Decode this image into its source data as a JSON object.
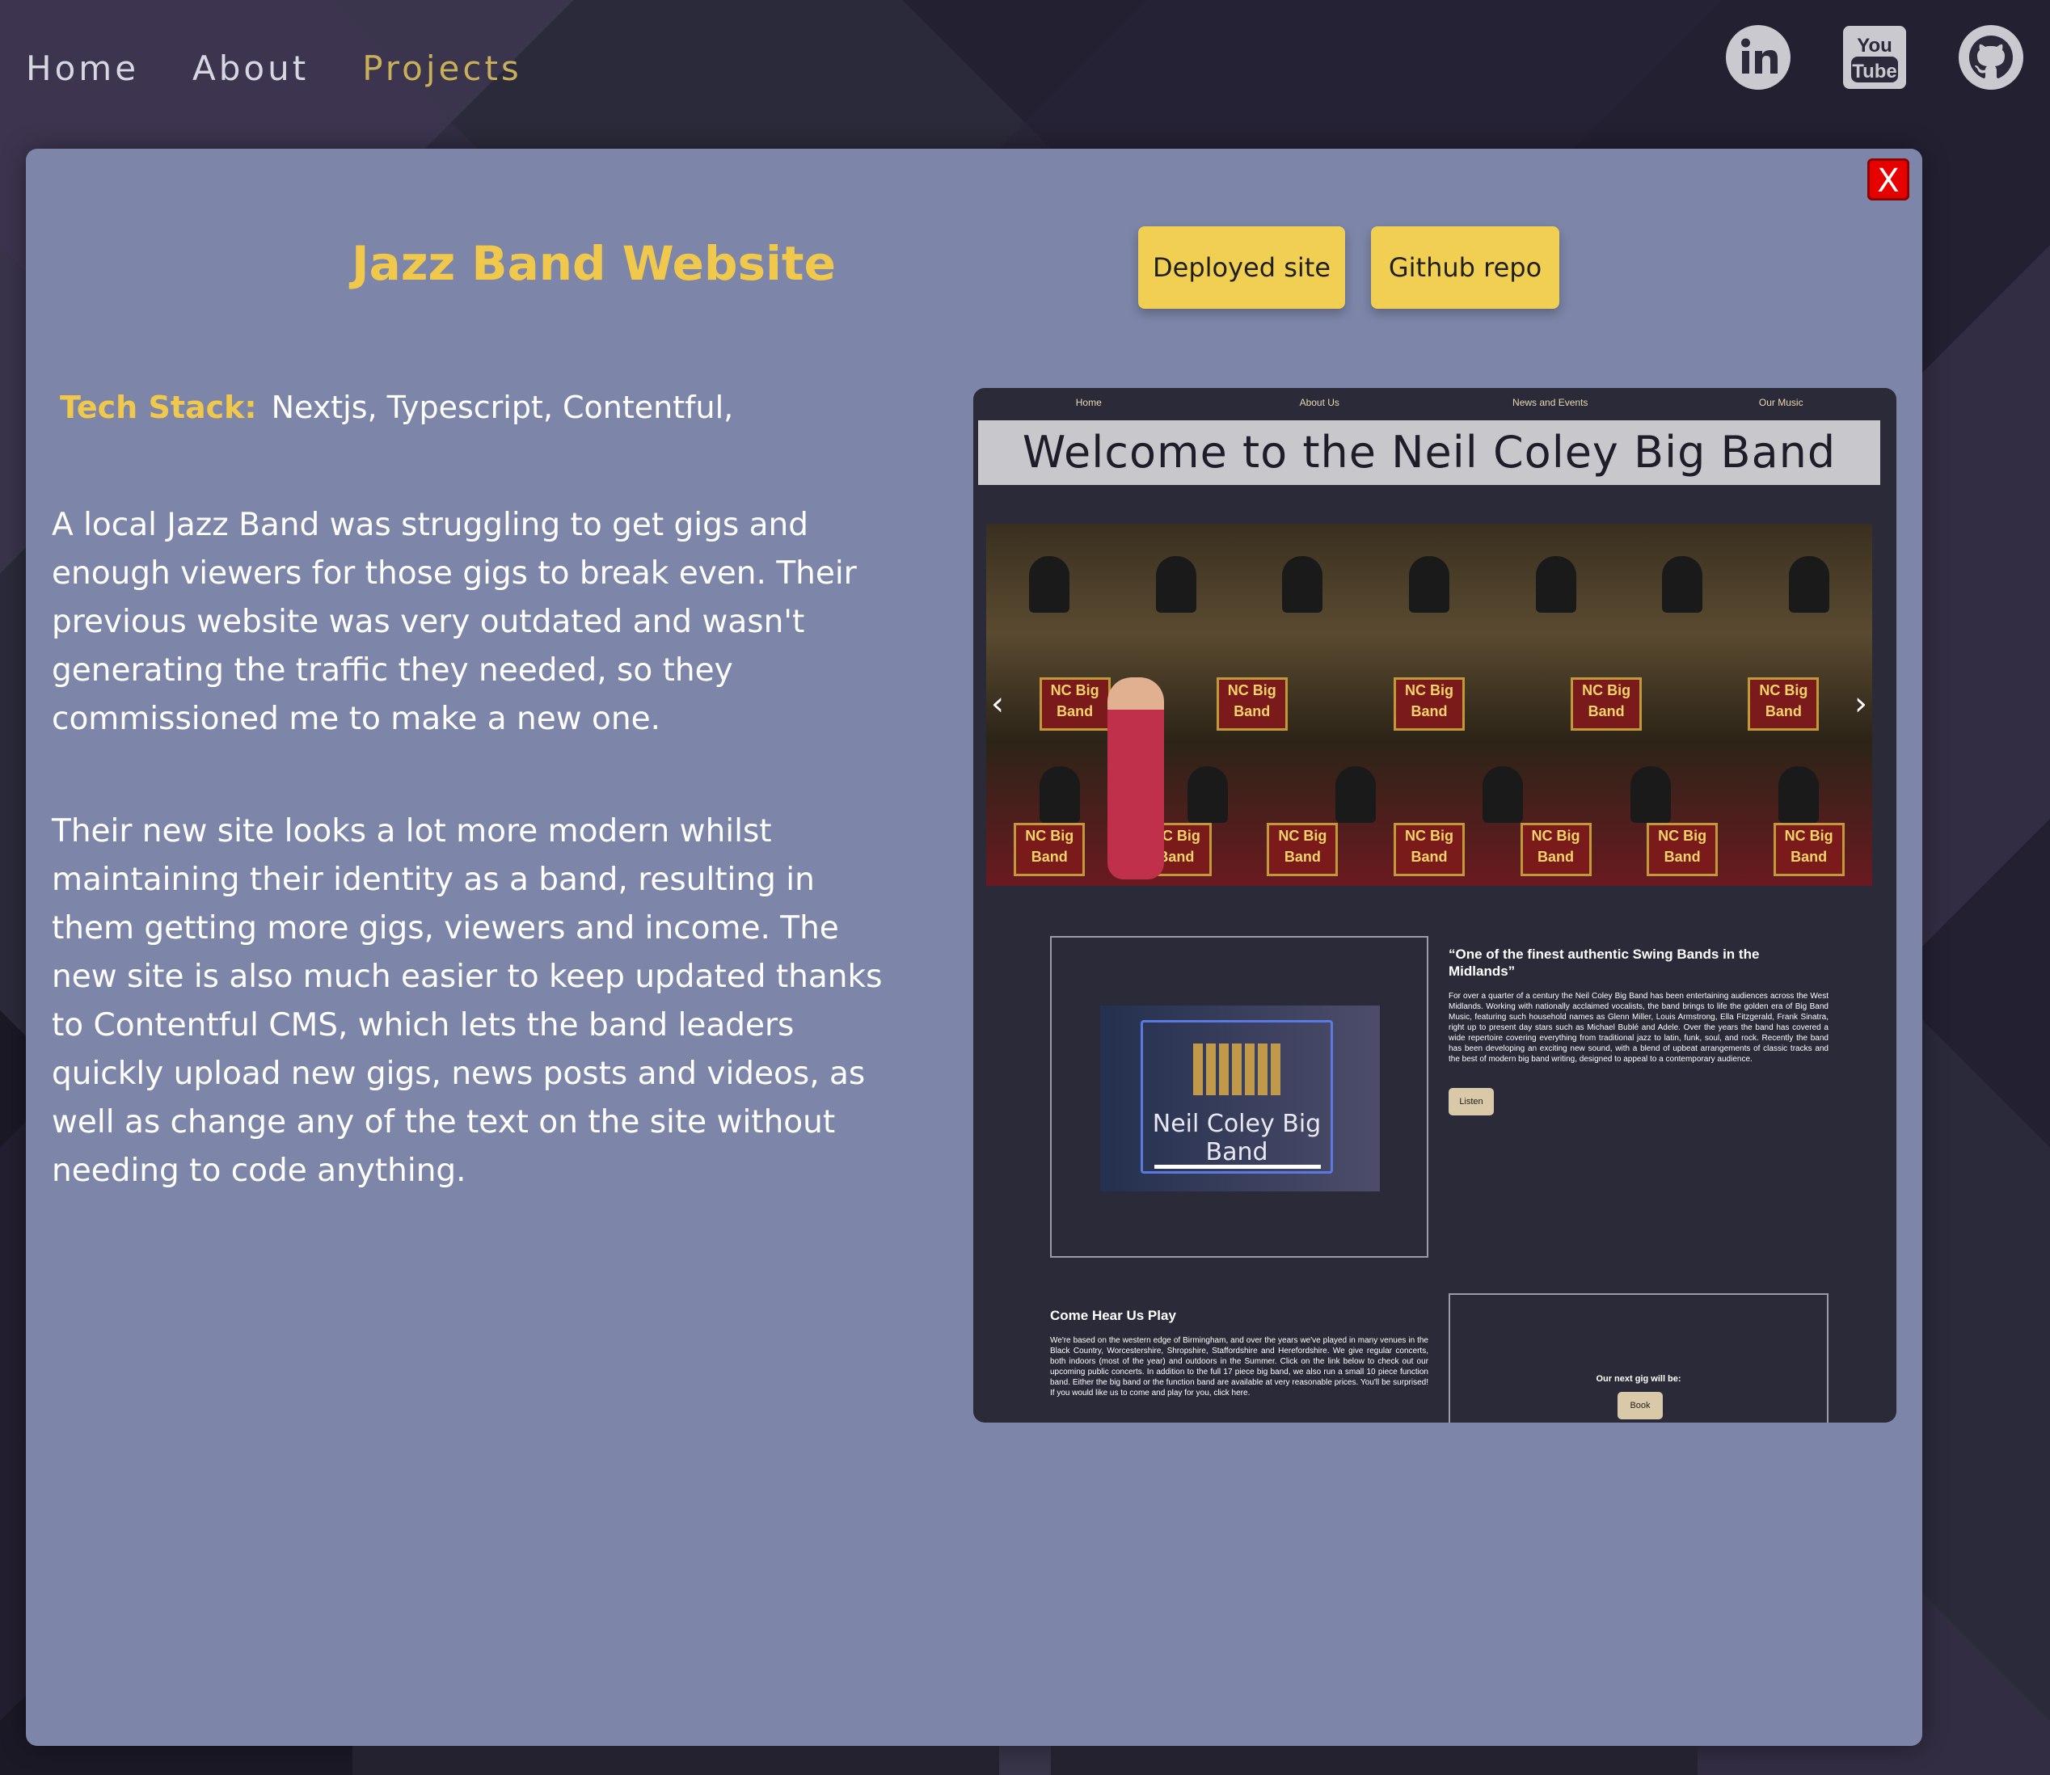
{
  "nav": {
    "items": [
      "Home",
      "About",
      "Projects"
    ],
    "active": "Projects"
  },
  "social": {
    "icons": [
      "linkedin-icon",
      "youtube-icon",
      "github-icon"
    ],
    "youtube_text": [
      "You",
      "Tube"
    ]
  },
  "modal": {
    "close_label": "X",
    "title": "Jazz Band Website",
    "buttons": {
      "deployed": "Deployed site",
      "github": "Github repo"
    },
    "tech_stack_label": "Tech Stack:",
    "tech_stack_value": "Nextjs, Typescript, Contentful,",
    "paragraph1": "A local Jazz Band was struggling to get gigs and enough viewers for those gigs to break even. Their previous website was very outdated and wasn't generating the traffic they needed, so they commissioned me to make a new one.",
    "paragraph2": "Their new site looks a lot more modern whilst maintaining their identity as a band, resulting in them getting more gigs, viewers and income. The new site is also much easier to keep updated thanks to Contentful CMS, which lets the band leaders quickly upload new gigs, news posts and videos, as well as change any of the text on the site without needing to code anything."
  },
  "preview": {
    "nav": [
      "Home",
      "About Us",
      "News and Events",
      "Our Music"
    ],
    "banner": "Welcome to the Neil Coley Big Band",
    "stand_text": "NC Big Band",
    "logo_text": "Neil Coley Big Band",
    "quote": "“One of the finest authentic Swing Bands in the Midlands”",
    "body": "For over a quarter of a century the Neil Coley Big Band has been entertaining audiences across the West Midlands. Working with nationally acclaimed vocalists, the band brings to life the golden era of Big Band Music, featuring such household names as Glenn Miller, Louis Armstrong, Ella Fitzgerald, Frank Sinatra, right up to present day stars such as Michael Bublé and Adele. Over the years the band has covered a wide repertoire covering everything from traditional jazz to latin, funk, soul, and rock. Recently the band has been developing an exciting new sound, with a blend of upbeat arrangements of classic tracks and the best of modern big band writing, designed to appeal to a contemporary audience.",
    "listen_label": "Listen",
    "come_title": "Come Hear Us Play",
    "come_body": "We're based on the western edge of Birmingham, and over the years we've played in many venues in the Black Country, Worcestershire, Shropshire, Staffordshire and Herefordshire. We give regular concerts, both indoors (most of the year) and outdoors in the Summer. Click on the link below to check out our upcoming public concerts. In addition to the full 17 piece big band, we also run a small 10 piece function band. Either the big band or the function band are available at very reasonable prices. You'll be surprised! If you would like us to come and play for you, click here.",
    "gig_label": "Our next gig will be:",
    "book_label": "Book"
  }
}
